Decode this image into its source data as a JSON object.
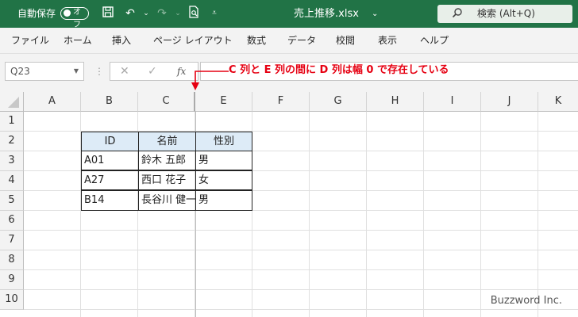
{
  "titlebar": {
    "autosave_label": "自動保存",
    "autosave_state": "オフ",
    "filename": "売上推移.xlsx",
    "filename_dropdown": "⌄",
    "search_label": "検索 (Alt+Q)",
    "bg_color": "#217346"
  },
  "ribbon": {
    "tabs": [
      "ファイル",
      "ホーム",
      "挿入",
      "ページ レイアウト",
      "数式",
      "データ",
      "校閲",
      "表示",
      "ヘルプ"
    ]
  },
  "formula_bar": {
    "name_box": "Q23",
    "fx": "fx",
    "content": ""
  },
  "annotation": {
    "text": "C 列と E 列の間に D 列は幅 0 で存在している",
    "color": "#e60012"
  },
  "grid": {
    "columns": [
      "A",
      "B",
      "C",
      "E",
      "F",
      "G",
      "H",
      "I",
      "J",
      "K"
    ],
    "rows": [
      "1",
      "2",
      "3",
      "4",
      "5",
      "6",
      "7",
      "8",
      "9",
      "10"
    ],
    "table": {
      "headers": [
        "ID",
        "名前",
        "性別"
      ],
      "rows": [
        [
          "A01",
          "鈴木 五郎",
          "男"
        ],
        [
          "A27",
          "西口 花子",
          "女"
        ],
        [
          "B14",
          "長谷川 健一",
          "男"
        ]
      ],
      "header_bg": "#ddebf7"
    }
  },
  "watermark": "Buzzword Inc."
}
